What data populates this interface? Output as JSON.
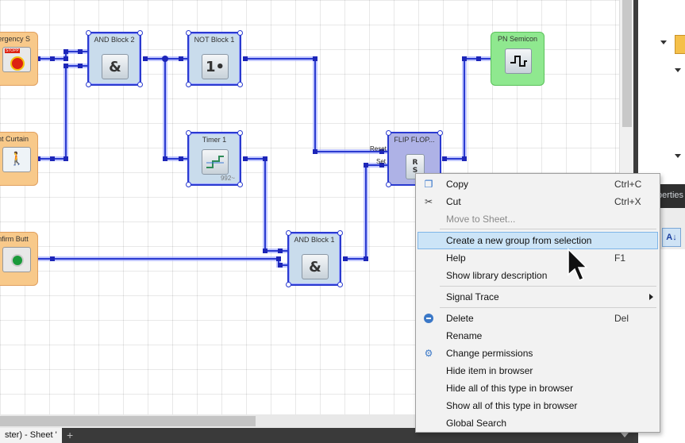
{
  "blocks": {
    "emergency": {
      "title": "mergency S",
      "icon": "emergency-stop-icon",
      "badge": "STOPP"
    },
    "light_curtain": {
      "title": "ght Curtain",
      "icon": "light-curtain-icon"
    },
    "confirm": {
      "title": "onfirm Butt",
      "icon": "confirm-button-icon"
    },
    "and2": {
      "title": "AND Block 2",
      "symbol": "&"
    },
    "not1": {
      "title": "NOT Block 1",
      "symbol": "1•"
    },
    "timer1": {
      "title": "Timer 1",
      "sub": "992~",
      "icon": "timer-icon"
    },
    "and1": {
      "title": "AND Block 1",
      "symbol": "&"
    },
    "flipflop": {
      "title": "FLIP FLOP...",
      "reset_label": "Reset",
      "set_label": "Set",
      "icon": "rs-flipflop-icon"
    },
    "pn_semicon": {
      "title": "PN Semicon",
      "icon": "pulse-output-icon"
    }
  },
  "properties_panel": {
    "title": "perties",
    "sort_icon": "sort-az-icon"
  },
  "tabs": {
    "active": "ster) - Sheet '",
    "add": "+"
  },
  "context_menu": {
    "items": [
      {
        "label": "Copy",
        "shortcut": "Ctrl+C",
        "icon": "copy-icon"
      },
      {
        "label": "Cut",
        "shortcut": "Ctrl+X",
        "icon": "scissors-icon"
      },
      {
        "label": "Move to Sheet...",
        "disabled": true
      },
      {
        "label": "Create a new group from selection",
        "highlighted": true
      },
      {
        "label": "Help",
        "shortcut": "F1"
      },
      {
        "label": "Show library description"
      },
      {
        "label": "Signal Trace",
        "submenu": true
      },
      {
        "label": "Delete",
        "shortcut": "Del",
        "icon": "delete-icon"
      },
      {
        "label": "Rename"
      },
      {
        "label": "Change permissions",
        "icon": "permissions-icon"
      },
      {
        "label": "Hide item in browser"
      },
      {
        "label": "Hide all of this type in browser"
      },
      {
        "label": "Show all of this type in browser"
      },
      {
        "label": "Global Search"
      }
    ]
  },
  "colors": {
    "wire": "#2a3ad0",
    "selection": "#9aa4ff",
    "menu_highlight": "#cce4f7"
  }
}
